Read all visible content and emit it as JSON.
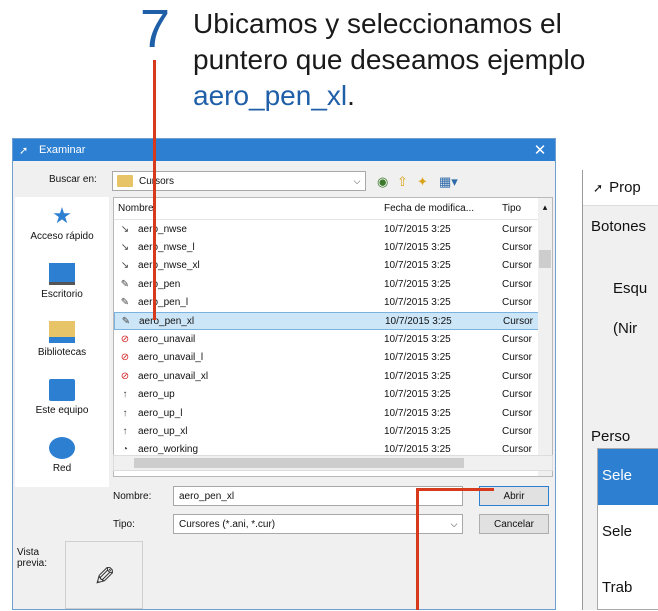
{
  "instruction": {
    "step_number": "7",
    "line1": "Ubicamos y seleccionamos el",
    "line2": "puntero que deseamos ejemplo",
    "highlight": "aero_pen_xl",
    "suffix": "."
  },
  "dialog": {
    "title": "Examinar",
    "close_glyph": "✕",
    "lookin_label": "Buscar en:",
    "lookin_value": "Cursors",
    "places": [
      "Acceso rápido",
      "Escritorio",
      "Bibliotecas",
      "Este equipo",
      "Red"
    ],
    "columns": {
      "name": "Nombre",
      "date": "Fecha de modifica...",
      "type": "Tipo"
    },
    "files": [
      {
        "name": "aero_nwse",
        "date": "10/7/2015 3:25",
        "type": "Cursor",
        "icon": "↘"
      },
      {
        "name": "aero_nwse_l",
        "date": "10/7/2015 3:25",
        "type": "Cursor",
        "icon": "↘"
      },
      {
        "name": "aero_nwse_xl",
        "date": "10/7/2015 3:25",
        "type": "Cursor",
        "icon": "↘"
      },
      {
        "name": "aero_pen",
        "date": "10/7/2015 3:25",
        "type": "Cursor",
        "icon": "✎"
      },
      {
        "name": "aero_pen_l",
        "date": "10/7/2015 3:25",
        "type": "Cursor",
        "icon": "✎"
      },
      {
        "name": "aero_pen_xl",
        "date": "10/7/2015 3:25",
        "type": "Cursor",
        "icon": "✎"
      },
      {
        "name": "aero_unavail",
        "date": "10/7/2015 3:25",
        "type": "Cursor",
        "icon": "⊘"
      },
      {
        "name": "aero_unavail_l",
        "date": "10/7/2015 3:25",
        "type": "Cursor",
        "icon": "⊘"
      },
      {
        "name": "aero_unavail_xl",
        "date": "10/7/2015 3:25",
        "type": "Cursor",
        "icon": "⊘"
      },
      {
        "name": "aero_up",
        "date": "10/7/2015 3:25",
        "type": "Cursor",
        "icon": "↑"
      },
      {
        "name": "aero_up_l",
        "date": "10/7/2015 3:25",
        "type": "Cursor",
        "icon": "↑"
      },
      {
        "name": "aero_up_xl",
        "date": "10/7/2015 3:25",
        "type": "Cursor",
        "icon": "↑"
      },
      {
        "name": "aero_working",
        "date": "10/7/2015 3:25",
        "type": "Cursor",
        "icon": "◔"
      }
    ],
    "selected_file": "aero_pen_xl",
    "filename_label": "Nombre:",
    "filename_value": "aero_pen_xl",
    "filetype_label": "Tipo:",
    "filetype_value": "Cursores (*.ani, *.cur)",
    "open_button": "Abrir",
    "cancel_button": "Cancelar",
    "preview_label": "Vista previa:"
  },
  "background_window": {
    "title": "Prop",
    "tab": "Botones",
    "scheme_label": "Esqu",
    "scheme_value": "(Nir",
    "customize_label": "Perso",
    "items": [
      "Sele",
      "Sele",
      "Trab"
    ]
  },
  "colors": {
    "accent": "#2d7fd1",
    "callout": "#d6391c",
    "selection": "#cce5f7",
    "step": "#1f5fa8"
  }
}
